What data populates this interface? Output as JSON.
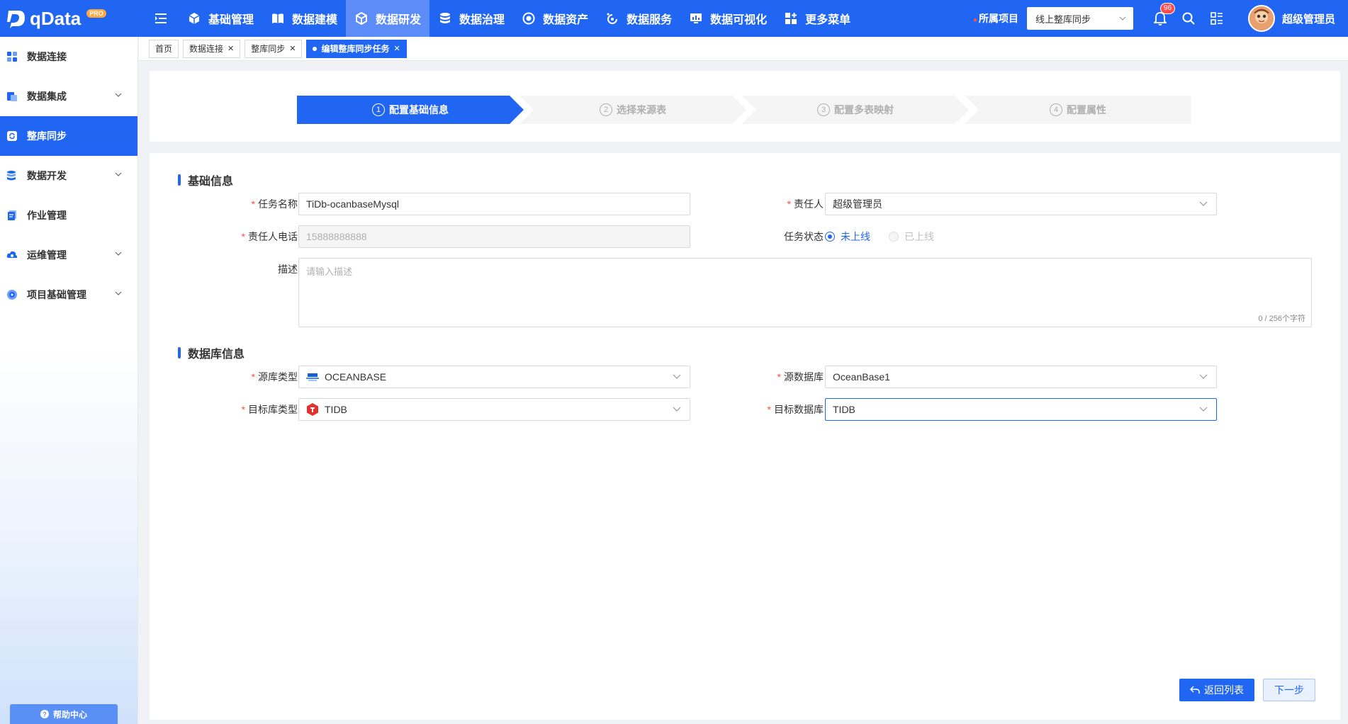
{
  "app": {
    "logo_text": "qData",
    "logo_badge": "PRO"
  },
  "topnav": {
    "items": [
      {
        "label": "基础管理",
        "icon": "cube-icon"
      },
      {
        "label": "数据建模",
        "icon": "book-icon"
      },
      {
        "label": "数据研发",
        "icon": "cube-3d-icon",
        "active": true
      },
      {
        "label": "数据治理",
        "icon": "database-stack-icon"
      },
      {
        "label": "数据资产",
        "icon": "target-icon"
      },
      {
        "label": "数据服务",
        "icon": "service-ring-icon"
      },
      {
        "label": "数据可视化",
        "icon": "screen-chart-icon"
      },
      {
        "label": "更多菜单",
        "icon": "grid-plus-icon"
      }
    ],
    "project_label": "所属项目",
    "project_value": "线上整库同步",
    "notification_count": "96",
    "user_name": "超级管理员"
  },
  "sidebar": {
    "items": [
      {
        "label": "数据连接",
        "icon": "connection-icon",
        "expandable": false
      },
      {
        "label": "数据集成",
        "icon": "integration-icon",
        "expandable": true
      },
      {
        "label": "整库同步",
        "icon": "sync-icon",
        "expandable": false,
        "active": true
      },
      {
        "label": "数据开发",
        "icon": "dev-icon",
        "expandable": true
      },
      {
        "label": "作业管理",
        "icon": "job-icon",
        "expandable": false
      },
      {
        "label": "运维管理",
        "icon": "ops-icon",
        "expandable": true
      },
      {
        "label": "项目基础管理",
        "icon": "project-icon",
        "expandable": true
      }
    ],
    "help_label": "帮助中心"
  },
  "tabs": [
    {
      "label": "首页",
      "closable": false
    },
    {
      "label": "数据连接",
      "closable": true
    },
    {
      "label": "整库同步",
      "closable": true
    },
    {
      "label": "编辑整库同步任务",
      "closable": true,
      "active": true
    }
  ],
  "steps": [
    {
      "num": "1",
      "label": "配置基础信息",
      "active": true
    },
    {
      "num": "2",
      "label": "选择来源表"
    },
    {
      "num": "3",
      "label": "配置多表映射"
    },
    {
      "num": "4",
      "label": "配置属性"
    }
  ],
  "basic": {
    "title": "基础信息",
    "task_name_label": "任务名称",
    "task_name_value": "TiDb-ocanbaseMysql",
    "owner_label": "责任人",
    "owner_value": "超级管理员",
    "phone_label": "责任人电话",
    "phone_value": "15888888888",
    "status_label": "任务状态",
    "status_offline": "未上线",
    "status_online": "已上线",
    "desc_label": "描述",
    "desc_placeholder": "请输入描述",
    "desc_counter": "0 / 256个字符"
  },
  "database": {
    "title": "数据库信息",
    "source_type_label": "源库类型",
    "source_type_value": "OCEANBASE",
    "source_db_label": "源数据库",
    "source_db_value": "OceanBase1",
    "target_type_label": "目标库类型",
    "target_type_value": "TIDB",
    "target_db_label": "目标数据库",
    "target_db_value": "TIDB"
  },
  "actions": {
    "back_label": "返回列表",
    "next_label": "下一步"
  },
  "colors": {
    "primary": "#2166f2",
    "required": "#ff4d4f"
  }
}
